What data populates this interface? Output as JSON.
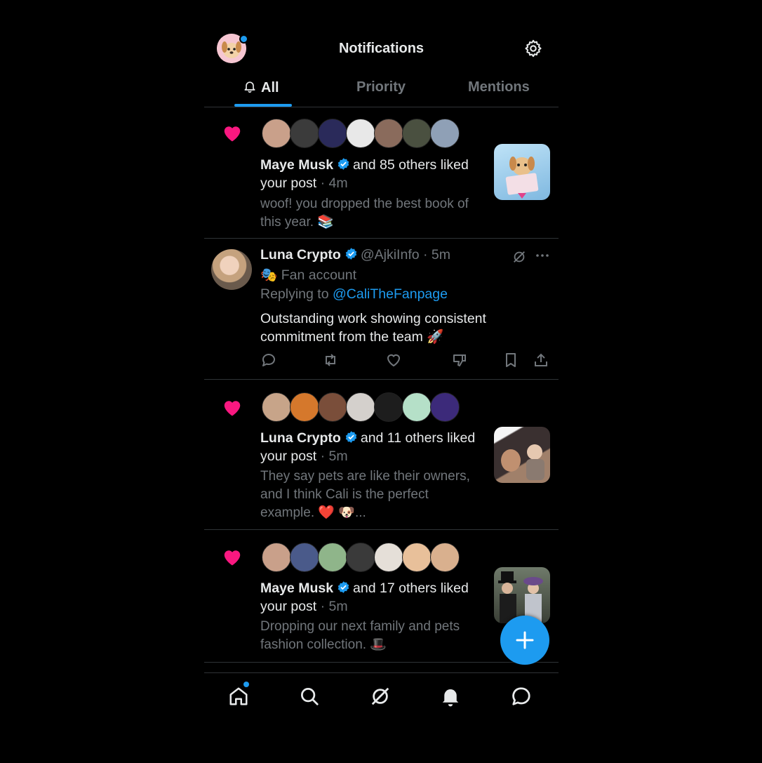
{
  "header": {
    "title": "Notifications"
  },
  "tabs": [
    {
      "label": "All"
    },
    {
      "label": "Priority"
    },
    {
      "label": "Mentions"
    }
  ],
  "notifications": [
    {
      "type": "like",
      "name": "Maye Musk",
      "action": "and 85 others liked",
      "action_line2": "your post",
      "time": "· 4m",
      "preview": "woof! you dropped the best book of this year. 📚",
      "avatar_colors": [
        "#c9a08a",
        "#3b3b3b",
        "#6a4bd1",
        "#e8e8e8",
        "#8a6b5c",
        "#4a5040",
        "#8fa0b6"
      ]
    },
    {
      "type": "reply",
      "name": "Luna Crypto",
      "handle": "@AjkiInfo",
      "time": "· 5m",
      "label": "Fan account",
      "label_icon": "🎭",
      "replying_prefix": "Replying to",
      "replying_to": "@CaliTheFanpage",
      "text": "Outstanding work showing consistent commitment from the team 🚀"
    },
    {
      "type": "like",
      "name": "Luna Crypto",
      "action": "and 11 others liked",
      "action_line2": "your post",
      "time": "· 5m",
      "preview": "They say pets are like their owners, and I think Cali is the perfect example. ❤️ 🐶...",
      "avatar_colors": [
        "#c7a489",
        "#d5782c",
        "#7a4e3a",
        "#d4d0cc",
        "#1d1d1d",
        "#b5e0c8",
        "#3c2a7a"
      ]
    },
    {
      "type": "like",
      "name": "Maye Musk",
      "action": "and 17 others liked",
      "action_line2": "your post",
      "time": "· 5m",
      "preview": "Dropping our next family and pets fashion collection. 🎩",
      "avatar_colors": [
        "#c9a08a",
        "#4a5a8a",
        "#8fb58a",
        "#3a3a3a",
        "#e5dfd8",
        "#e8c09a",
        "#d9b08e"
      ]
    }
  ],
  "colors": {
    "accent": "#1d9bf0",
    "heart": "#f91880",
    "text_secondary": "#71767b"
  },
  "icons": [
    "gear-icon",
    "bell-icon",
    "heart-icon",
    "verified-icon",
    "reply-icon",
    "retweet-icon",
    "like-icon",
    "dislike-icon",
    "bookmark-icon",
    "share-icon",
    "grok-icon",
    "more-icon",
    "plus-icon",
    "home-icon",
    "search-icon",
    "messages-icon"
  ]
}
